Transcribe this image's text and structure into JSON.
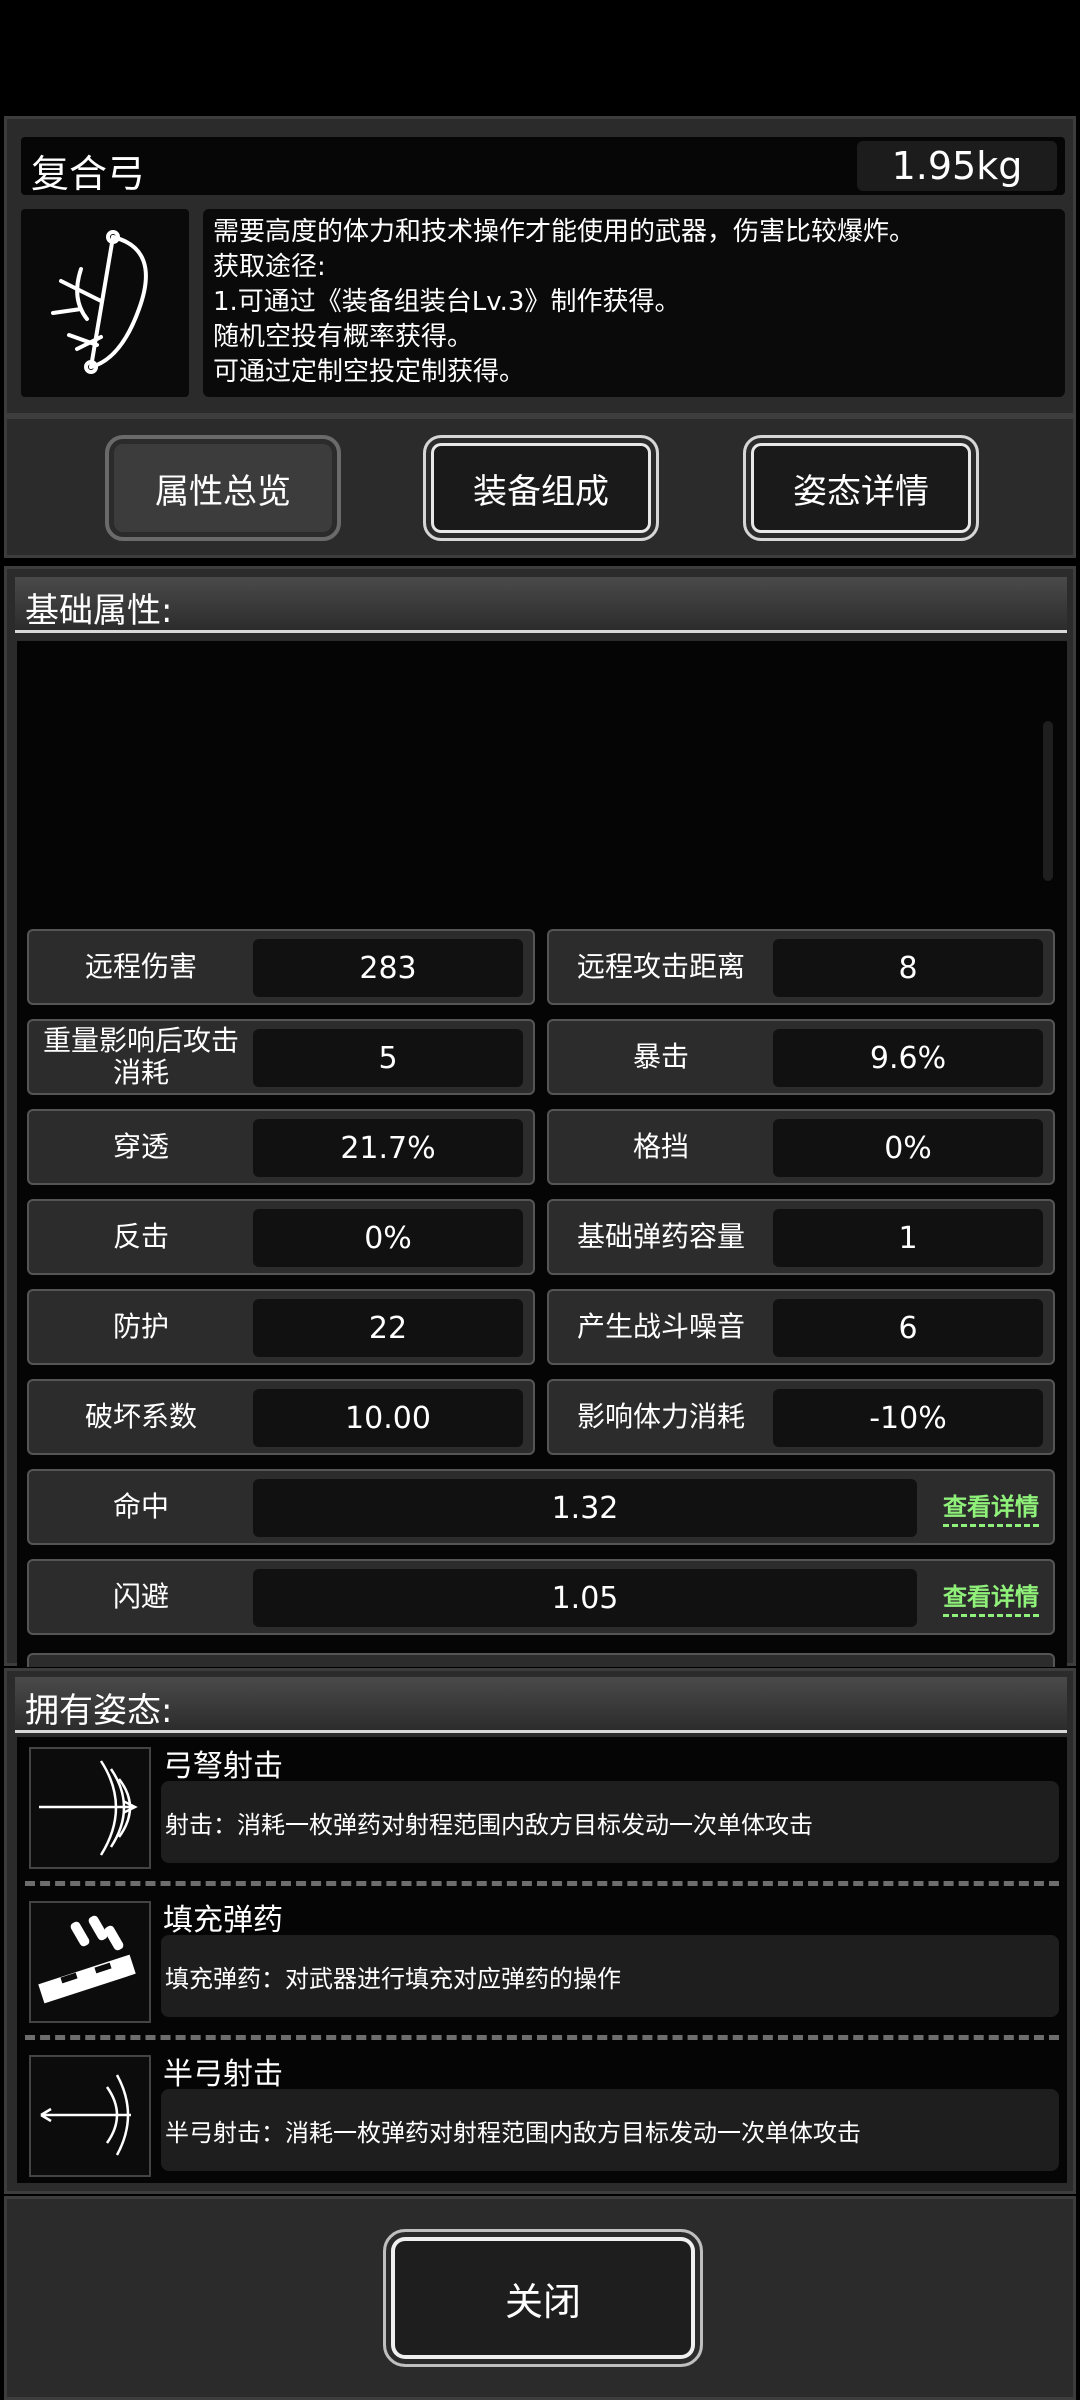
{
  "item": {
    "name": "复合弓",
    "weight": "1.95kg",
    "description_lines": [
      "需要高度的体力和技术操作才能使用的武器，伤害比较爆炸。",
      "获取途径:",
      "1.可通过《装备组装台Lv.3》制作获得。",
      "随机空投有概率获得。",
      "可通过定制空投定制获得。"
    ]
  },
  "tabs": [
    {
      "label": "属性总览",
      "active": true
    },
    {
      "label": "装备组成",
      "active": false
    },
    {
      "label": "姿态详情",
      "active": false
    }
  ],
  "base_attributes": {
    "heading": "基础属性:",
    "stats_half": [
      {
        "label": "远程伤害",
        "value": "283"
      },
      {
        "label": "远程攻击距离",
        "value": "8"
      },
      {
        "label": "重量影响后攻击消耗",
        "value": "5"
      },
      {
        "label": "暴击",
        "value": "9.6%"
      },
      {
        "label": "穿透",
        "value": "21.7%"
      },
      {
        "label": "格挡",
        "value": "0%"
      },
      {
        "label": "反击",
        "value": "0%"
      },
      {
        "label": "基础弹药容量",
        "value": "1"
      },
      {
        "label": "防护",
        "value": "22"
      },
      {
        "label": "产生战斗噪音",
        "value": "6"
      },
      {
        "label": "破坏系数",
        "value": "10.00"
      },
      {
        "label": "影响体力消耗",
        "value": "-10%"
      }
    ],
    "stats_full": [
      {
        "label": "命中",
        "value": "1.32",
        "link": "查看详情"
      },
      {
        "label": "闪避",
        "value": "1.05",
        "link": "查看详情"
      }
    ]
  },
  "poses": {
    "heading": "拥有姿态:",
    "items": [
      {
        "name": "弓弩射击",
        "desc": "射击：消耗一枚弹药对射程范围内敌方目标发动一次单体攻击",
        "icon": "bow-shot-icon"
      },
      {
        "name": "填充弹药",
        "desc": "填充弹药：对武器进行填充对应弹药的操作",
        "icon": "reload-ammo-icon"
      },
      {
        "name": "半弓射击",
        "desc": "半弓射击：消耗一枚弹药对射程范围内敌方目标发动一次单体攻击",
        "icon": "half-bow-shot-icon"
      }
    ]
  },
  "close_label": "关闭",
  "colors": {
    "link": "#8ff07a",
    "panel": "#2b2b2b",
    "field": "#111111"
  }
}
